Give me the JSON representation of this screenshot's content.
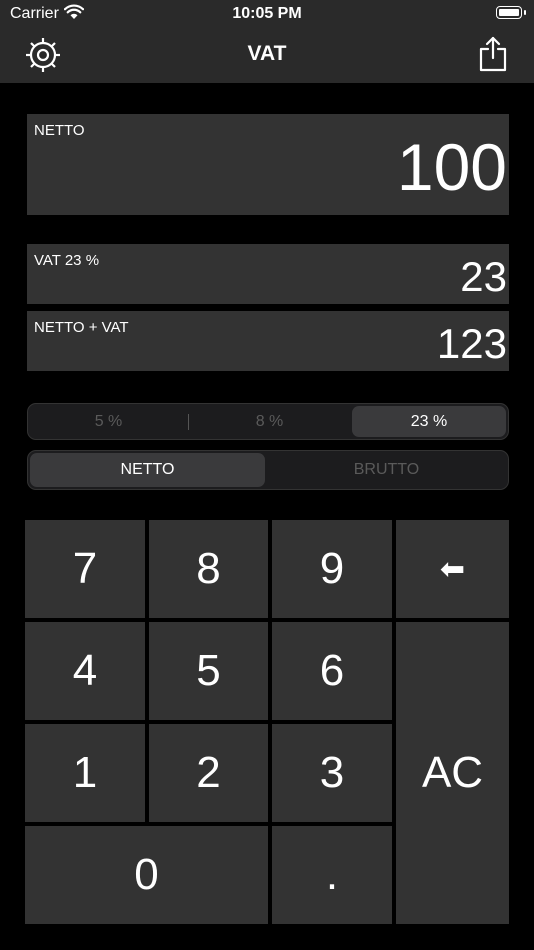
{
  "status_bar": {
    "carrier": "Carrier",
    "time": "10:05 PM"
  },
  "nav": {
    "title": "VAT",
    "left_icon": "gear-icon",
    "right_icon": "share-icon"
  },
  "netto": {
    "label": "NETTO",
    "value": "100"
  },
  "vat": {
    "label": "VAT 23 %",
    "value": "23"
  },
  "total": {
    "label": "NETTO + VAT",
    "value": "123"
  },
  "rate_options": [
    "5 %",
    "8 %",
    "23 %"
  ],
  "rate_selected": "23 %",
  "mode_options": [
    "NETTO",
    "BRUTTO"
  ],
  "mode_selected": "NETTO",
  "keypad": {
    "k7": "7",
    "k8": "8",
    "k9": "9",
    "back": "⬅",
    "k4": "4",
    "k5": "5",
    "k6": "6",
    "k1": "1",
    "k2": "2",
    "k3": "3",
    "clear": "AC",
    "k0": "0",
    "dot": "."
  },
  "colors": {
    "background": "#000000",
    "panel": "#333333",
    "bar": "#2a2a2a",
    "active_segment": "#3a3a3c"
  }
}
